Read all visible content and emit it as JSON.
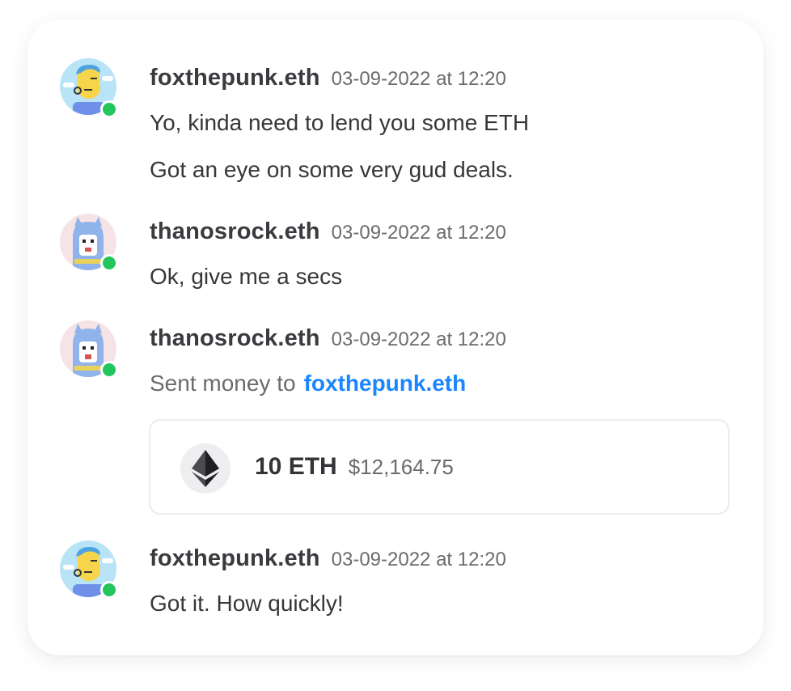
{
  "colors": {
    "accent_link": "#1a85ff",
    "online": "#22c55e"
  },
  "messages": [
    {
      "username": "foxthepunk.eth",
      "timestamp": "03-09-2022 at 12:20",
      "avatar_icon": "fox-punk-avatar-icon",
      "lines": [
        "Yo, kinda need to lend you some ETH",
        "Got an eye on some very gud deals."
      ]
    },
    {
      "username": "thanosrock.eth",
      "timestamp": "03-09-2022 at 12:20",
      "avatar_icon": "thanos-rock-avatar-icon",
      "lines": [
        "Ok, give me a secs"
      ]
    },
    {
      "username": "thanosrock.eth",
      "timestamp": "03-09-2022 at 12:20",
      "avatar_icon": "thanos-rock-avatar-icon",
      "sent_prefix": "Sent money to",
      "recipient": "foxthepunk.eth",
      "transaction": {
        "token_icon": "ethereum-icon",
        "amount": "10 ETH",
        "usd_value": "$12,164.75"
      }
    },
    {
      "username": "foxthepunk.eth",
      "timestamp": "03-09-2022 at 12:20",
      "avatar_icon": "fox-punk-avatar-icon",
      "lines": [
        "Got it. How quickly!"
      ]
    }
  ]
}
